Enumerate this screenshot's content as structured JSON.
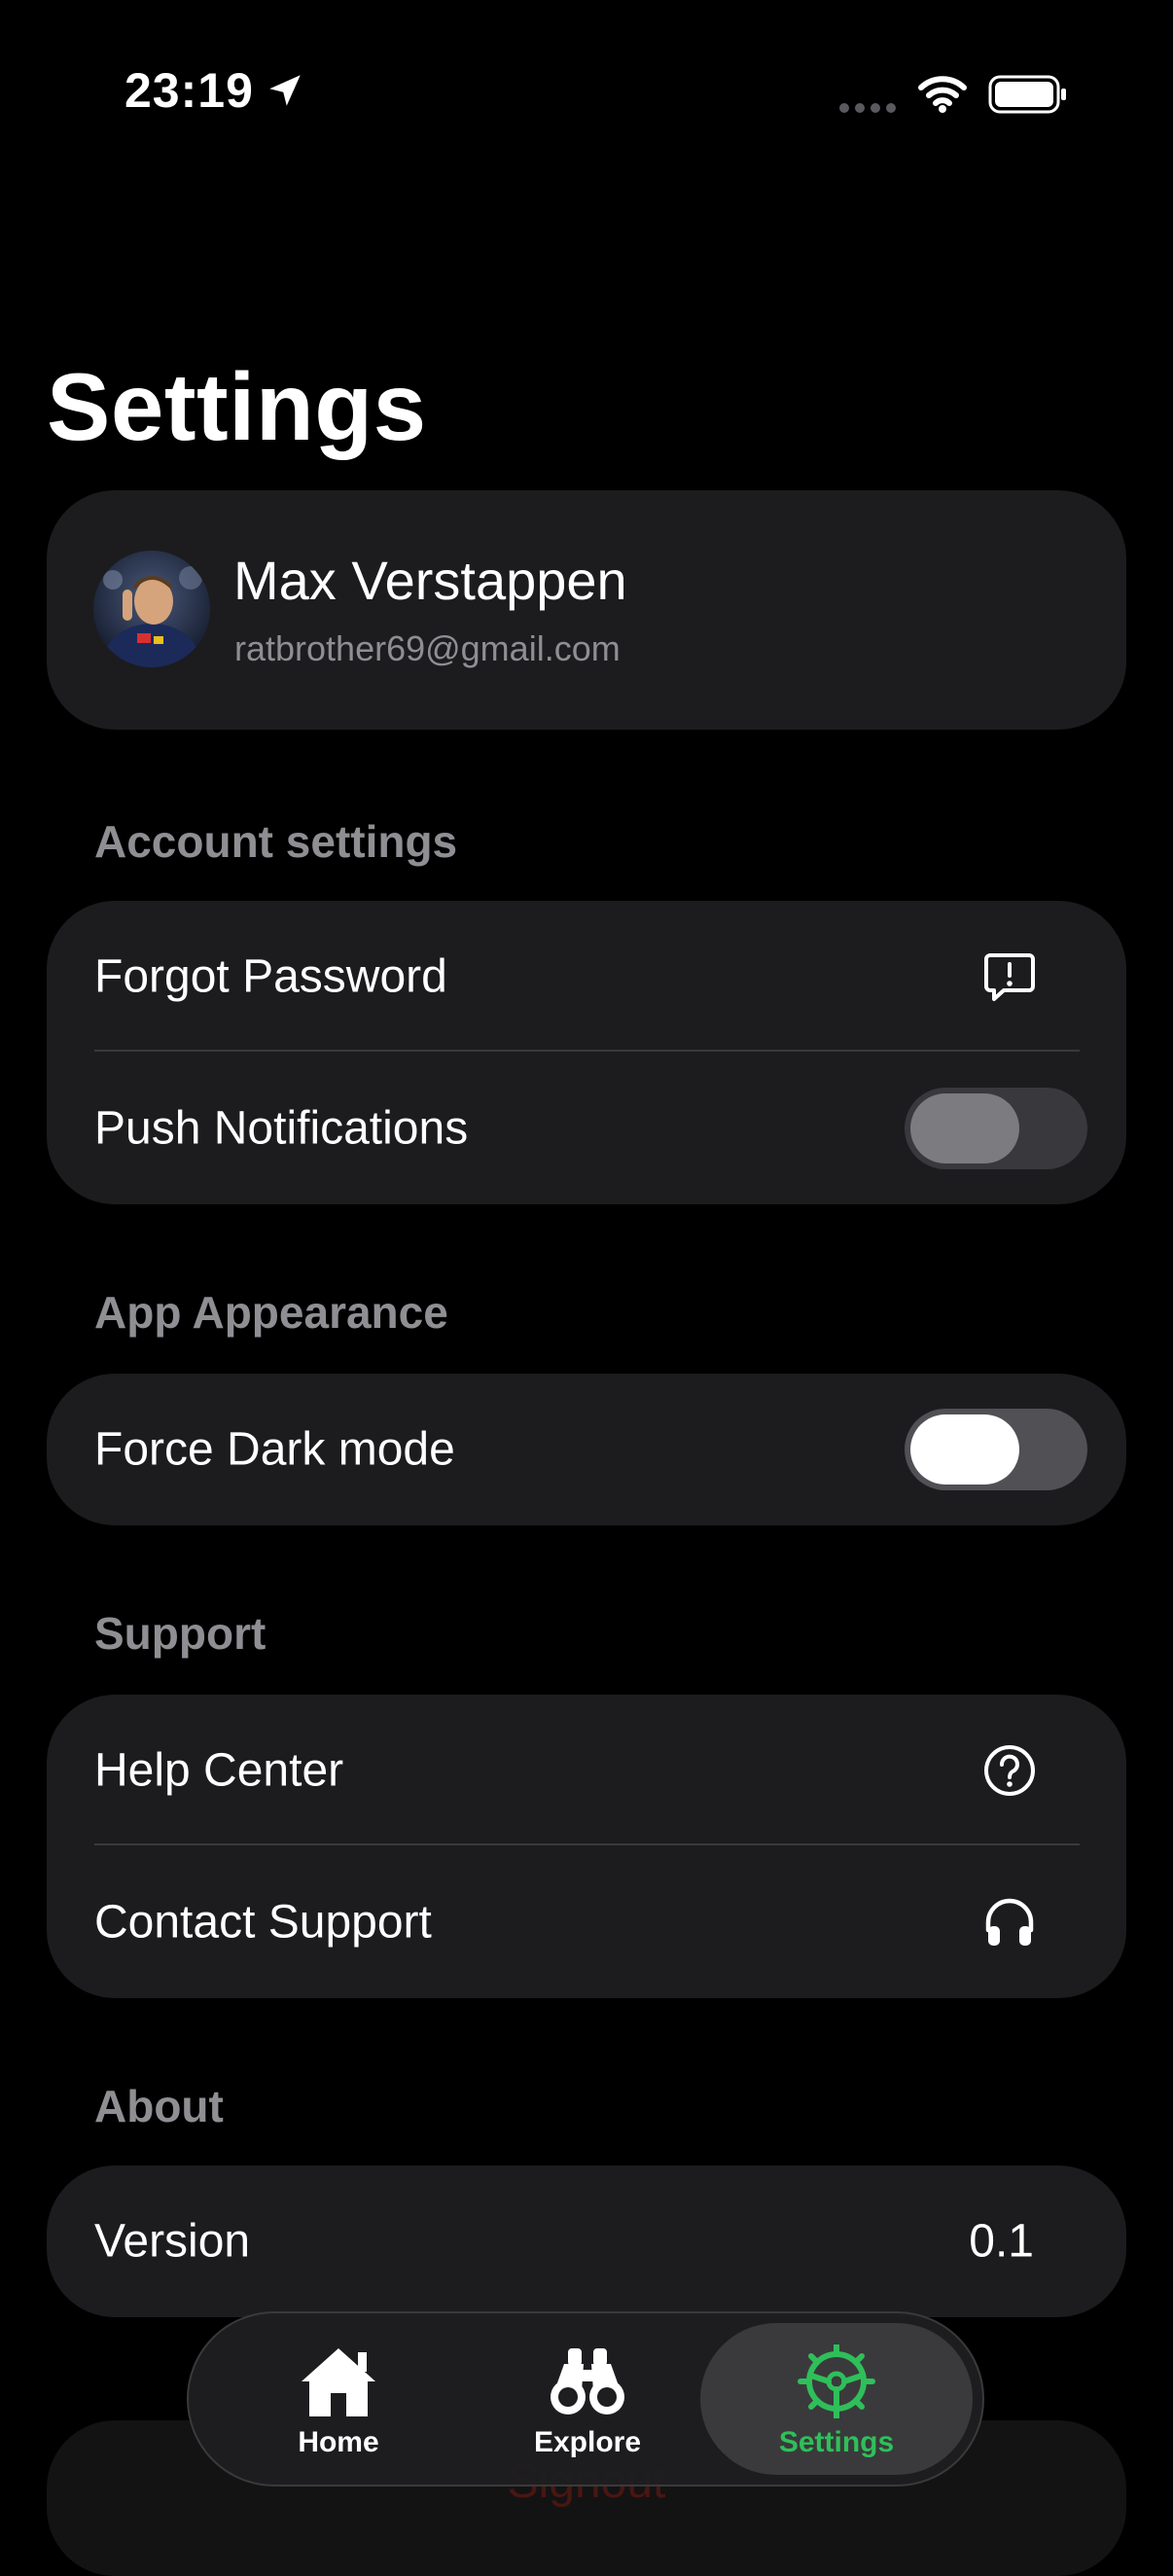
{
  "status_bar": {
    "time": "23:19"
  },
  "page": {
    "title": "Settings"
  },
  "profile": {
    "name": "Max Verstappen",
    "email": "ratbrother69@gmail.com"
  },
  "sections": {
    "account": {
      "header": "Account settings",
      "forgot_password": "Forgot Password",
      "push_notifications": "Push Notifications",
      "push_notifications_on": false
    },
    "appearance": {
      "header": "App Appearance",
      "force_dark_mode": "Force Dark mode",
      "force_dark_mode_on": false
    },
    "support": {
      "header": "Support",
      "help_center": "Help Center",
      "contact_support": "Contact Support"
    },
    "about": {
      "header": "About",
      "version_label": "Version",
      "version_value": "0.1"
    }
  },
  "signout": {
    "label": "Signout"
  },
  "tab_bar": {
    "tabs": [
      {
        "label": "Home",
        "icon": "house-icon",
        "active": false
      },
      {
        "label": "Explore",
        "icon": "binoculars-icon",
        "active": false
      },
      {
        "label": "Settings",
        "icon": "steering-wheel-gear-icon",
        "active": true
      }
    ]
  },
  "colors": {
    "background": "#000000",
    "card": "#1c1c1e",
    "secondary_text": "#8e8e93",
    "accent_green": "#2fbf5a",
    "signout_red": "#4a1612"
  }
}
